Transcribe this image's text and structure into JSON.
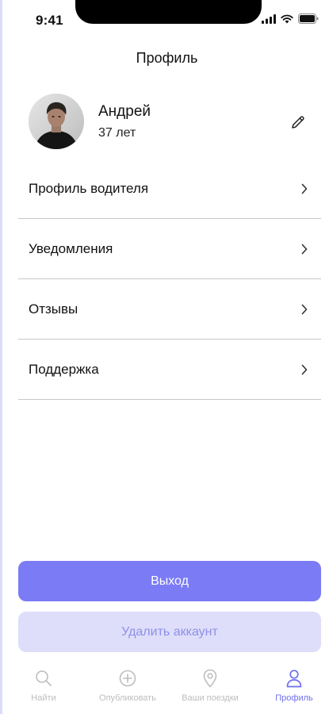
{
  "status_bar": {
    "time": "9:41"
  },
  "header": {
    "title": "Профиль"
  },
  "profile": {
    "name": "Андрей",
    "age": "37 лет",
    "edit_icon": "pencil-icon"
  },
  "menu": {
    "items": [
      {
        "label": "Профиль водителя"
      },
      {
        "label": "Уведомления"
      },
      {
        "label": "Отзывы"
      },
      {
        "label": "Поддержка"
      }
    ]
  },
  "actions": {
    "logout_label": "Выход",
    "delete_label": "Удалить аккаунт"
  },
  "tabbar": {
    "tabs": [
      {
        "label": "Найти",
        "icon": "search-icon",
        "active": false
      },
      {
        "label": "Опубликовать",
        "icon": "plus-circle-icon",
        "active": false
      },
      {
        "label": "Ваши поездки",
        "icon": "map-pin-icon",
        "active": false
      },
      {
        "label": "Профиль",
        "icon": "user-icon",
        "active": true
      }
    ]
  },
  "colors": {
    "accent": "#7b7bf6",
    "accent_light": "#dedefa",
    "accent_text_muted": "#8f8fe8",
    "tab_inactive": "#bdbdbd",
    "tab_active": "#6f6ff0"
  }
}
